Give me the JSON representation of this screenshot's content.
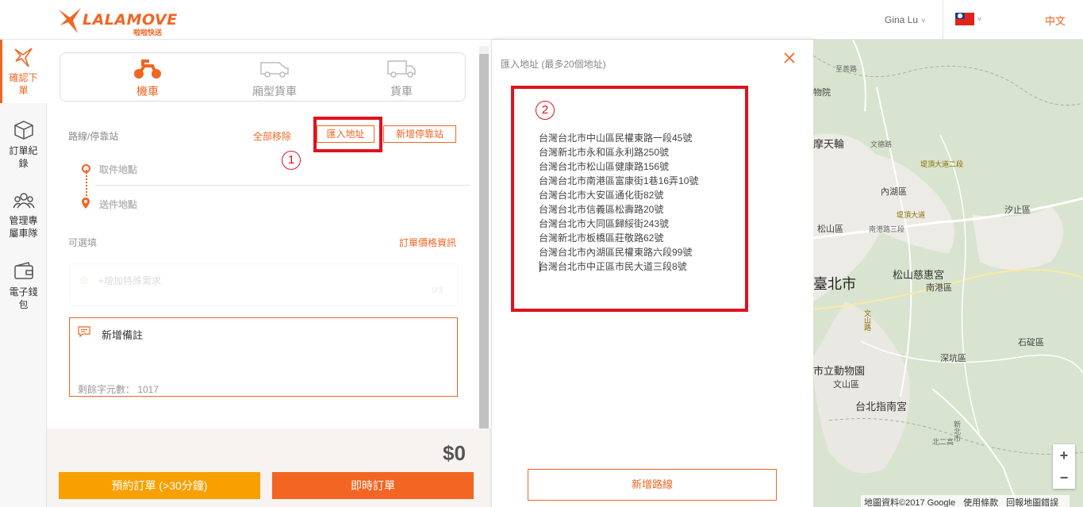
{
  "header": {
    "logo_text": "LALAMOVE",
    "logo_sub": "啦啦快送",
    "user_name": "Gina Lu",
    "language": "中文"
  },
  "sidebar": {
    "items": [
      {
        "label": "確認下單",
        "icon": "bird-logo-icon",
        "active": true
      },
      {
        "label": "訂單紀錄",
        "icon": "box-icon",
        "active": false
      },
      {
        "label": "管理專屬車隊",
        "icon": "team-icon",
        "active": false
      },
      {
        "label": "電子錢包",
        "icon": "wallet-icon",
        "active": false
      }
    ]
  },
  "vehicles": [
    {
      "label": "機車",
      "icon": "motorcycle-icon",
      "active": true
    },
    {
      "label": "廂型貨車",
      "icon": "van-icon",
      "active": false
    },
    {
      "label": "貨車",
      "icon": "truck-icon",
      "active": false
    }
  ],
  "route": {
    "label": "路線/停靠站",
    "remove_all": "全部移除",
    "import_address": "匯入地址",
    "add_stop": "新增停靠站",
    "pickup": "取件地點",
    "dropoff": "送件地點",
    "marker1": "1"
  },
  "options": {
    "optional_label": "可選填",
    "price_info": "訂單價格資訊",
    "special_request": "+增加特殊需求",
    "special_count": "0/3",
    "note_label": "新增備註",
    "note_remaining": "剩餘字元數： 1017"
  },
  "footer": {
    "price": "$0",
    "schedule_button": "預約訂單 (>30分鐘)",
    "now_button": "即時訂單"
  },
  "import_panel": {
    "title": "匯入地址 (最多20個地址)",
    "marker2": "2",
    "addresses": [
      "台灣台北市中山區民權東路一段45號",
      "台灣新北市永和區永利路250號",
      "台灣台北市松山區健康路156號",
      "台灣台北市南港區富康街1巷16弄10號",
      "台灣台北市大安區通化街82號",
      "台灣台北市信義區松壽路20號",
      "台灣台北市大同區歸綏街243號",
      "台灣新北市板橋區莊敬路62號",
      "台灣台北市內湖區民權東路六段99號",
      "台灣台北市中正區市民大道三段8號"
    ],
    "add_route_button": "新增路線"
  },
  "map": {
    "labels": [
      "物院",
      "摩天輪",
      "文德路",
      "內湖區",
      "汐止區",
      "堤頂大道",
      "南港路三段",
      "松山區",
      "松山慈惠宮",
      "臺北市",
      "南港區",
      "文山路",
      "石碇區",
      "深坑區",
      "市立動物園",
      "文山區",
      "台北指南宮",
      "至善路",
      "新北市",
      "北二高",
      "堤頂大道二段"
    ],
    "zoom_in": "+",
    "zoom_out": "−",
    "attribution": [
      "地圖資料©2017 Google",
      "使用條款",
      "回報地圖錯誤"
    ]
  },
  "colors": {
    "accent": "#f16522",
    "schedule": "#f7a000",
    "highlight": "#e0121f"
  }
}
